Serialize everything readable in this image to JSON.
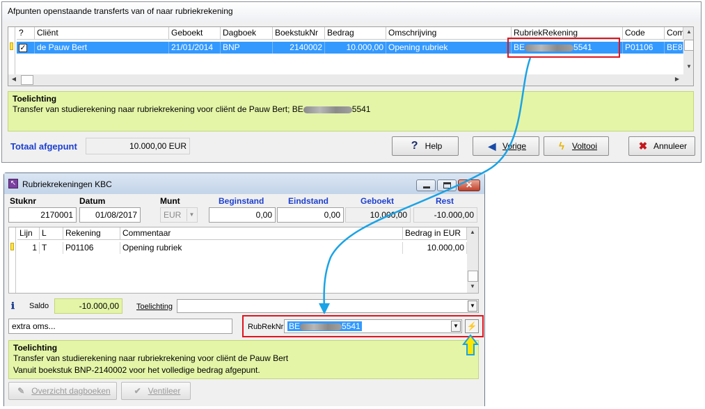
{
  "top_window": {
    "title": "Afpunten openstaande transferts van of naar rubriekrekening",
    "columns": [
      "?",
      "Cliënt",
      "Geboekt",
      "Dagboek",
      "BoekstukNr",
      "Bedrag",
      "Omschrijving",
      "RubriekRekening",
      "Code",
      "Com"
    ],
    "row": {
      "check": "✓",
      "client": "de Pauw Bert",
      "geboekt": "21/01/2014",
      "dagboek": "BNP",
      "boekstuknr": "2140002",
      "bedrag": "10.000,00",
      "omschrijving": "Opening rubriek",
      "rubriek_prefix": "BE",
      "rubriek_suffix": "5541",
      "code": "P01106",
      "com": "BE8"
    },
    "note": {
      "title": "Toelichting",
      "line_prefix": "Transfer van studierekening naar rubriekrekening voor cliënt de Pauw Bert; BE",
      "line_suffix": "5541"
    },
    "total_label": "Totaal afgepunt",
    "total_value": "10.000,00 EUR",
    "buttons": {
      "help": "Help",
      "vorige": "Vorige",
      "voltooi": "Voltooi",
      "annuleer": "Annuleer"
    }
  },
  "bottom_window": {
    "title": "Rubriekrekeningen KBC",
    "labels": {
      "stuknr": "Stuknr",
      "datum": "Datum",
      "munt": "Munt",
      "beginstand": "Beginstand",
      "eindstand": "Eindstand",
      "geboekt": "Geboekt",
      "rest": "Rest"
    },
    "values": {
      "stuknr": "2170001",
      "datum": "01/08/2017",
      "munt": "EUR",
      "beginstand": "0,00",
      "eindstand": "0,00",
      "geboekt": "10.000,00",
      "rest": "-10.000,00"
    },
    "columns": [
      "Lijn",
      "L",
      "Rekening",
      "Commentaar",
      "Bedrag in EUR"
    ],
    "row": {
      "lijn": "1",
      "l": "T",
      "rekening": "P01106",
      "commentaar": "Opening rubriek",
      "bedrag": "10.000,00"
    },
    "saldo_label": "Saldo",
    "saldo_value": "-10.000,00",
    "toelichting_label": "Toelichting",
    "extra_oms": "extra oms...",
    "rubreknr_label": "RubRekNr",
    "rubreknr_prefix": "BE",
    "rubreknr_suffix": "5541",
    "note": {
      "title": "Toelichting",
      "line1": "Transfer van studierekening naar rubriekrekening voor cliënt de Pauw Bert",
      "line2": "Vanuit boekstuk BNP-2140002 voor het volledige bedrag afgepunt."
    },
    "buttons": {
      "overzicht": "Overzicht dagboeken",
      "ventileer": "Ventileer"
    }
  },
  "colors": {
    "selection": "#3399ff",
    "note_bg": "#e4f5a8",
    "highlight_red": "#e0141e",
    "arrow_blue": "#1aa3e6"
  }
}
